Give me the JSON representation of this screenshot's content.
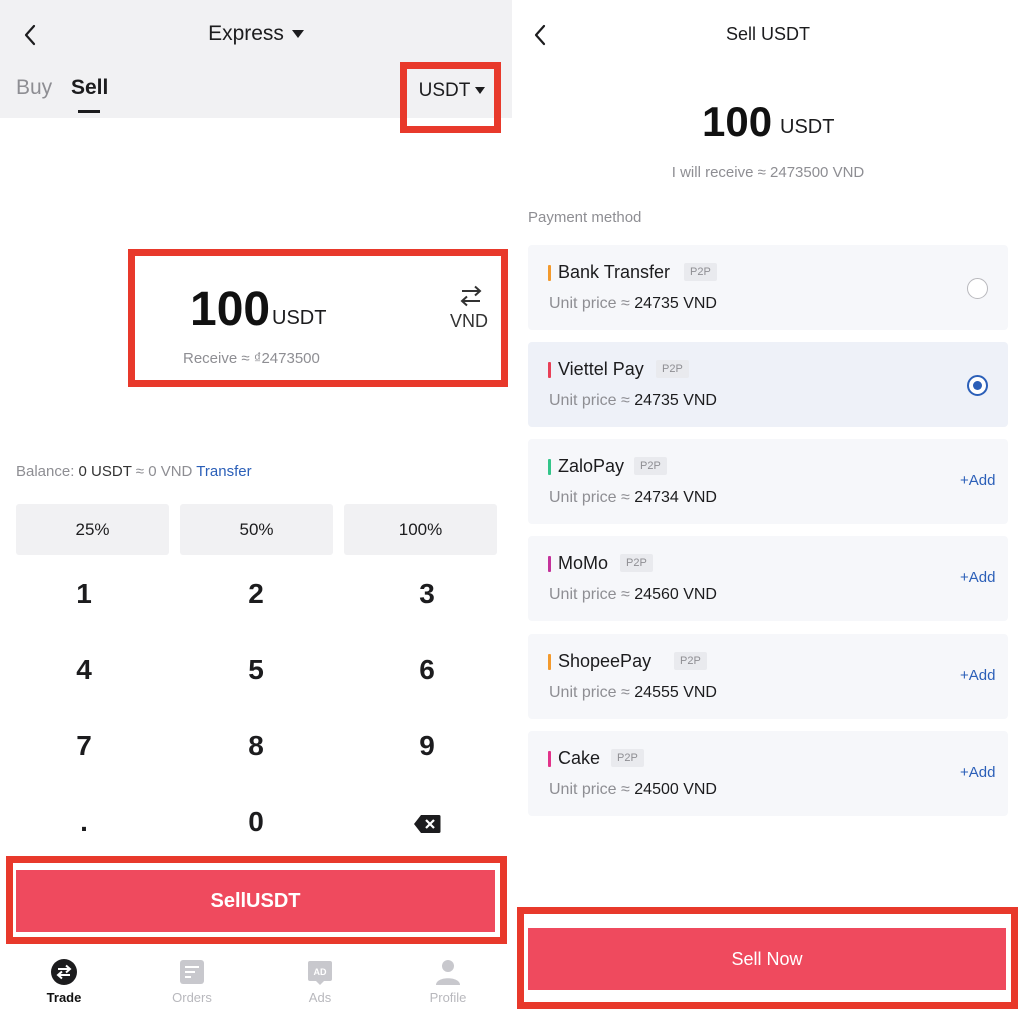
{
  "left": {
    "header": {
      "title": "Express"
    },
    "tabs": {
      "buy": "Buy",
      "sell": "Sell"
    },
    "asset_select": {
      "value": "USDT"
    },
    "amount": {
      "value": "100",
      "unit": "USDT",
      "swap_label": "VND",
      "receive": "Receive ≈ ₫2473500"
    },
    "balance": {
      "label": "Balance:",
      "value": "0 USDT",
      "approx": "≈ 0 VND",
      "transfer": "Transfer"
    },
    "percent_buttons": [
      "25%",
      "50%",
      "100%"
    ],
    "keypad": [
      "1",
      "2",
      "3",
      "4",
      "5",
      "6",
      "7",
      "8",
      "9",
      ".",
      "0"
    ],
    "sell_button": "SellUSDT",
    "bottom_nav": [
      {
        "label": "Trade",
        "icon": "trade-icon",
        "active": true
      },
      {
        "label": "Orders",
        "icon": "orders-icon",
        "active": false
      },
      {
        "label": "Ads",
        "icon": "ads-icon",
        "active": false,
        "icon_text": "AD"
      },
      {
        "label": "Profile",
        "icon": "profile-icon",
        "active": false
      }
    ]
  },
  "right": {
    "header": {
      "title": "Sell USDT"
    },
    "amount": {
      "value": "100",
      "unit": "USDT"
    },
    "receive": "I will receive ≈ 2473500 VND",
    "payment_label": "Payment method",
    "unit_price_label": "Unit price ≈",
    "methods": [
      {
        "name": "Bank Transfer",
        "tag": "P2P",
        "price": "24735 VND",
        "color": "#f39a2d",
        "action": "radio",
        "selected": false
      },
      {
        "name": "Viettel Pay",
        "tag": "P2P",
        "price": "24735 VND",
        "color": "#e84057",
        "action": "radio",
        "selected": true
      },
      {
        "name": "ZaloPay",
        "tag": "P2P",
        "price": "24734 VND",
        "color": "#33c58a",
        "action": "+Add"
      },
      {
        "name": "MoMo",
        "tag": "P2P",
        "price": "24560 VND",
        "color": "#c4329b",
        "action": "+Add"
      },
      {
        "name": "ShopeePay",
        "tag": "P2P",
        "price": "24555 VND",
        "color": "#f39a2d",
        "action": "+Add"
      },
      {
        "name": "Cake",
        "tag": "P2P",
        "price": "24500 VND",
        "color": "#e2338a",
        "action": "+Add"
      }
    ],
    "sell_button": "Sell Now"
  },
  "colors": {
    "accent": "#ef4a5e",
    "highlight_box": "#e8392b",
    "link": "#2b5fb8"
  }
}
